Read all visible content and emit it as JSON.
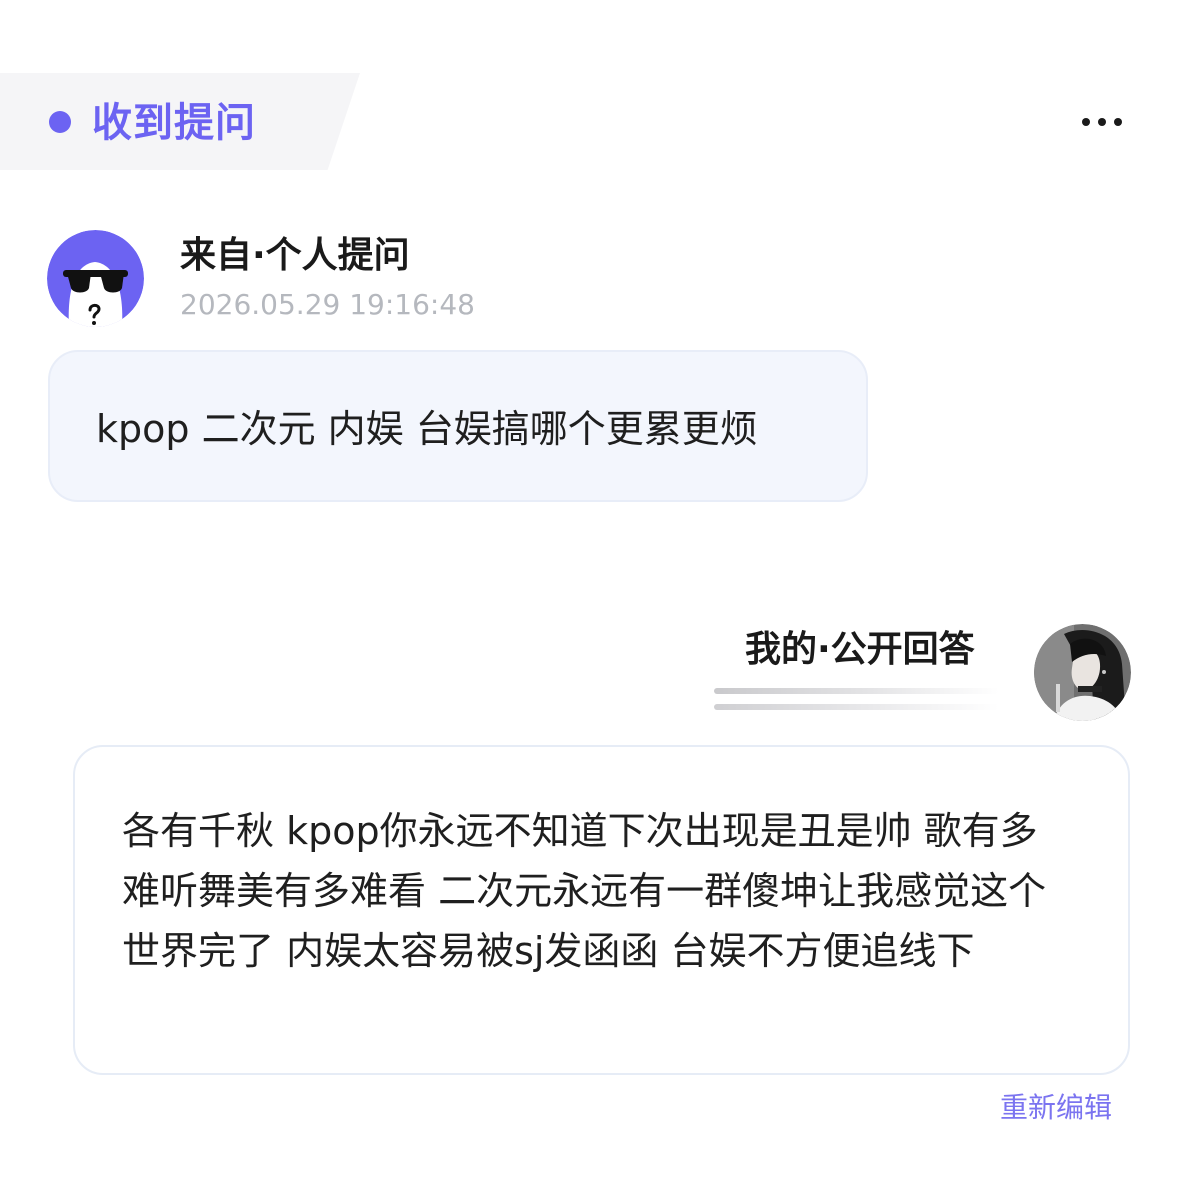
{
  "header": {
    "title": "收到提问",
    "more_icon": "more-horizontal-icon",
    "accent_color": "#6c63f2"
  },
  "question": {
    "asker_label": "来自·个人提问",
    "timestamp": "2026.05.29 19:16:48",
    "avatar_icon": "anonymous-sunglasses-avatar",
    "text": "kpop 二次元 内娱 台娱搞哪个更累更烦"
  },
  "answer": {
    "label": "我的·公开回答",
    "avatar_icon": "user-photo-avatar",
    "text": "各有千秋 kpop你永远不知道下次出现是丑是帅 歌有多难听舞美有多难看 二次元永远有一群傻坤让我感觉这个世界完了 内娱太容易被sj发函函 台娱不方便追线下",
    "edit_label": "重新编辑"
  }
}
